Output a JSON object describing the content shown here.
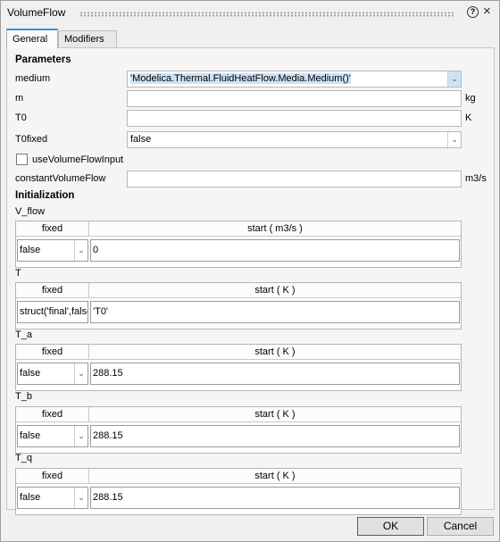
{
  "window": {
    "title": "VolumeFlow"
  },
  "tabs": [
    {
      "label": "General",
      "active": true
    },
    {
      "label": "Modifiers",
      "active": false
    }
  ],
  "parameters": {
    "heading": "Parameters",
    "medium": {
      "label": "medium",
      "value": "'Modelica.Thermal.FluidHeatFlow.Media.Medium()'"
    },
    "m": {
      "label": "m",
      "value": "",
      "unit": "kg"
    },
    "T0": {
      "label": "T0",
      "value": "",
      "unit": "K"
    },
    "T0fixed": {
      "label": "T0fixed",
      "value": "false"
    },
    "useVolumeFlowInput": {
      "label": "useVolumeFlowInput",
      "checked": false
    },
    "constantVolumeFlow": {
      "label": "constantVolumeFlow",
      "value": "",
      "unit": "m3/s"
    }
  },
  "initialization": {
    "heading": "Initialization",
    "groups": [
      {
        "name": "V_flow",
        "fixed_header": "fixed",
        "start_header": "start ( m3/s )",
        "fixed": "false",
        "start": "0"
      },
      {
        "name": "T",
        "fixed_header": "fixed",
        "start_header": "start ( K )",
        "fixed": "struct('final',false",
        "start": "'T0'"
      },
      {
        "name": "T_a",
        "fixed_header": "fixed",
        "start_header": "start ( K )",
        "fixed": "false",
        "start": "288.15"
      },
      {
        "name": "T_b",
        "fixed_header": "fixed",
        "start_header": "start ( K )",
        "fixed": "false",
        "start": "288.15"
      },
      {
        "name": "T_q",
        "fixed_header": "fixed",
        "start_header": "start ( K )",
        "fixed": "false",
        "start": "288.15"
      }
    ]
  },
  "buttons": {
    "ok": "OK",
    "cancel": "Cancel"
  },
  "icons": {
    "help": "?",
    "close": "×",
    "dropdown": "⌄"
  }
}
